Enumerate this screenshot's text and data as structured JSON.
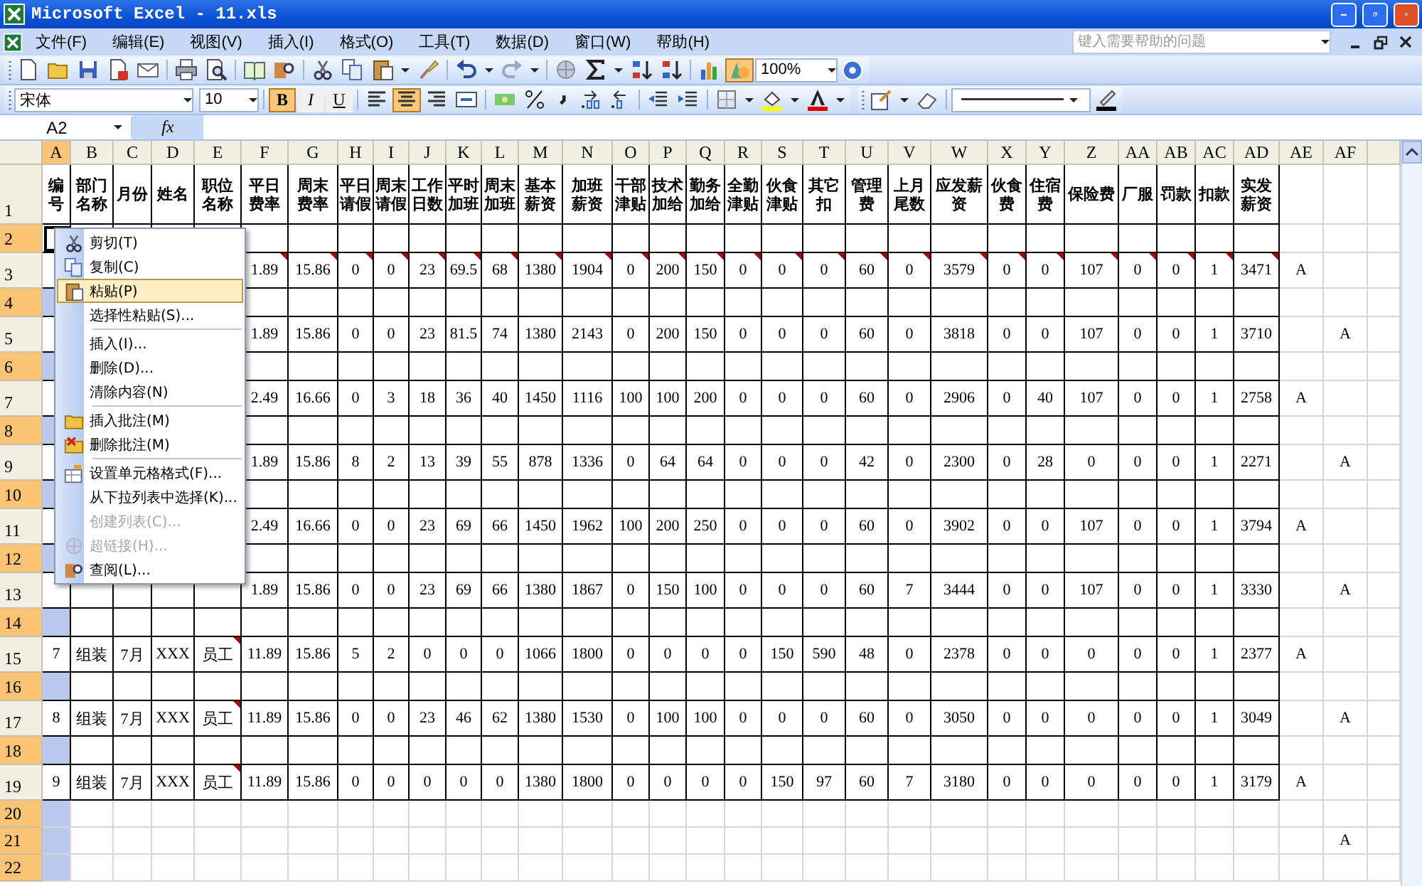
{
  "window": {
    "title": "Microsoft Excel - 11.xls"
  },
  "menu_bar": [
    "文件(F)",
    "编辑(E)",
    "视图(V)",
    "插入(I)",
    "格式(O)",
    "工具(T)",
    "数据(D)",
    "窗口(W)",
    "帮助(H)"
  ],
  "help_box": {
    "placeholder": "键入需要帮助的问题"
  },
  "standard_toolbar": {
    "zoom": "100%",
    "buttons": [
      {
        "pressed": false
      },
      {
        "pressed": false
      },
      {
        "pressed": false
      },
      {
        "pressed": false
      },
      {
        "pressed": false
      },
      {
        "pressed": false
      },
      {
        "pressed": false
      },
      {
        "pressed": false
      },
      {
        "pressed": false
      },
      {
        "pressed": false
      },
      {
        "pressed": false
      },
      {
        "pressed": false
      },
      {
        "pressed": false
      },
      {
        "pressed": false
      },
      {
        "pressed": false
      },
      {
        "pressed": false
      },
      {
        "pressed": false
      },
      {
        "pressed": false
      },
      {
        "pressed": false
      },
      {
        "pressed": false
      },
      {
        "pressed": true
      }
    ]
  },
  "formatting_toolbar": {
    "font": "宋体",
    "size": "10",
    "style_buttons": [
      {
        "label": "B",
        "pressed": true
      },
      {
        "label": "I",
        "pressed": false
      },
      {
        "label": "U",
        "pressed": false
      }
    ],
    "align_buttons": [
      {
        "pressed": false
      },
      {
        "pressed": true
      },
      {
        "pressed": false
      },
      {
        "pressed": false
      }
    ]
  },
  "formula_bar": {
    "name_box": "A2",
    "fx": "fx"
  },
  "sheet": {
    "columns": [
      {
        "label": "A",
        "selected": true
      },
      {
        "label": "B",
        "selected": false
      },
      {
        "label": "C",
        "selected": false
      },
      {
        "label": "D",
        "selected": false
      },
      {
        "label": "E",
        "selected": false
      },
      {
        "label": "F",
        "selected": false
      },
      {
        "label": "G",
        "selected": false
      },
      {
        "label": "H",
        "selected": false
      },
      {
        "label": "I",
        "selected": false
      },
      {
        "label": "J",
        "selected": false
      },
      {
        "label": "K",
        "selected": false
      },
      {
        "label": "L",
        "selected": false
      },
      {
        "label": "M",
        "selected": false
      },
      {
        "label": "N",
        "selected": false
      },
      {
        "label": "O",
        "selected": false
      },
      {
        "label": "P",
        "selected": false
      },
      {
        "label": "Q",
        "selected": false
      },
      {
        "label": "R",
        "selected": false
      },
      {
        "label": "S",
        "selected": false
      },
      {
        "label": "T",
        "selected": false
      },
      {
        "label": "U",
        "selected": false
      },
      {
        "label": "V",
        "selected": false
      },
      {
        "label": "W",
        "selected": false
      },
      {
        "label": "X",
        "selected": false
      },
      {
        "label": "Y",
        "selected": false
      },
      {
        "label": "Z",
        "selected": false
      },
      {
        "label": "AA",
        "selected": false
      },
      {
        "label": "AB",
        "selected": false
      },
      {
        "label": "AC",
        "selected": false
      },
      {
        "label": "AD",
        "selected": false
      },
      {
        "label": "AE",
        "selected": false
      },
      {
        "label": "AF",
        "selected": false
      }
    ],
    "rows": [
      {
        "label": "1",
        "kind": "header",
        "selected": false,
        "cells": [
          "编号",
          "部门名称",
          "月份",
          "姓名",
          "职位名称",
          "平日费率",
          "周末费率",
          "平日请假",
          "周末请假",
          "工作日数",
          "平时加班",
          "周末加班",
          "基本薪资",
          "加班薪资",
          "干部津贴",
          "技术加给",
          "勤务加给",
          "全勤津贴",
          "伙食津贴",
          "其它扣",
          "管理费",
          "上月尾数",
          "应发薪资",
          "伙食费",
          "住宿费",
          "保险费",
          "厂服",
          "罚款",
          "扣款",
          "实发薪资"
        ]
      },
      {
        "label": "2",
        "kind": "blank",
        "selected": true,
        "cells": [
          {
            "active": true
          }
        ]
      },
      {
        "label": "3",
        "kind": "data",
        "selected": false,
        "cells": [
          null,
          null,
          null,
          null,
          null,
          {
            "text": "1.89",
            "comment": true
          },
          {
            "text": "15.86",
            "comment": true
          },
          {
            "text": "0",
            "comment": true
          },
          {
            "text": "0",
            "comment": true
          },
          {
            "text": "23",
            "comment": true
          },
          {
            "text": "69.5",
            "comment": true
          },
          {
            "text": "68",
            "comment": true
          },
          {
            "text": "1380",
            "comment": true
          },
          {
            "text": "1904",
            "comment": true
          },
          {
            "text": "0",
            "comment": true
          },
          {
            "text": "200",
            "comment": true
          },
          {
            "text": "150",
            "comment": true
          },
          {
            "text": "0",
            "comment": true
          },
          {
            "text": "0",
            "comment": true
          },
          {
            "text": "0",
            "comment": true
          },
          {
            "text": "60",
            "comment": true
          },
          {
            "text": "0",
            "comment": true
          },
          {
            "text": "3579",
            "comment": true
          },
          {
            "text": "0",
            "comment": true
          },
          {
            "text": "0",
            "comment": true
          },
          {
            "text": "107",
            "comment": true
          },
          {
            "text": "0",
            "comment": true
          },
          {
            "text": "0",
            "comment": true
          },
          {
            "text": "1",
            "comment": true
          },
          {
            "text": "3471",
            "comment": true
          },
          "A"
        ]
      },
      {
        "label": "4",
        "kind": "blank",
        "selected": true
      },
      {
        "label": "5",
        "kind": "data",
        "selected": false,
        "cells": [
          null,
          null,
          null,
          null,
          null,
          "1.89",
          "15.86",
          "0",
          "0",
          "23",
          "81.5",
          "74",
          "1380",
          "2143",
          "0",
          "200",
          "150",
          "0",
          "0",
          "0",
          "60",
          "0",
          "3818",
          "0",
          "0",
          "107",
          "0",
          "0",
          "1",
          "3710",
          null,
          "A"
        ]
      },
      {
        "label": "6",
        "kind": "blank",
        "selected": true
      },
      {
        "label": "7",
        "kind": "data",
        "selected": false,
        "cells": [
          null,
          null,
          null,
          null,
          null,
          "2.49",
          "16.66",
          "0",
          "3",
          "18",
          "36",
          "40",
          "1450",
          "1116",
          "100",
          "100",
          "200",
          "0",
          "0",
          "0",
          "60",
          "0",
          "2906",
          "0",
          "40",
          "107",
          "0",
          "0",
          "1",
          "2758",
          "A"
        ]
      },
      {
        "label": "8",
        "kind": "blank",
        "selected": true
      },
      {
        "label": "9",
        "kind": "data",
        "selected": false,
        "cells": [
          null,
          null,
          null,
          null,
          null,
          "1.89",
          "15.86",
          "8",
          "2",
          "13",
          "39",
          "55",
          "878",
          "1336",
          "0",
          "64",
          "64",
          "0",
          "0",
          "0",
          "42",
          "0",
          "2300",
          "0",
          "28",
          "0",
          "0",
          "0",
          "1",
          "2271",
          null,
          "A"
        ]
      },
      {
        "label": "10",
        "kind": "blank",
        "selected": true
      },
      {
        "label": "11",
        "kind": "data",
        "selected": false,
        "cells": [
          null,
          null,
          null,
          null,
          null,
          "2.49",
          "16.66",
          "0",
          "0",
          "23",
          "69",
          "66",
          "1450",
          "1962",
          "100",
          "200",
          "250",
          "0",
          "0",
          "0",
          "60",
          "0",
          "3902",
          "0",
          "0",
          "107",
          "0",
          "0",
          "1",
          "3794",
          "A"
        ]
      },
      {
        "label": "12",
        "kind": "blank",
        "selected": true
      },
      {
        "label": "13",
        "kind": "data",
        "selected": false,
        "cells": [
          null,
          null,
          null,
          null,
          null,
          "1.89",
          "15.86",
          "0",
          "0",
          "23",
          "69",
          "66",
          "1380",
          "1867",
          "0",
          "150",
          "100",
          "0",
          "0",
          "0",
          "60",
          "7",
          "3444",
          "0",
          "0",
          "107",
          "0",
          "0",
          "1",
          "3330",
          null,
          "A"
        ]
      },
      {
        "label": "14",
        "kind": "blank",
        "selected": true
      },
      {
        "label": "15",
        "kind": "data",
        "selected": false,
        "cells": [
          "7",
          "组装",
          "7月",
          "XXX",
          {
            "text": "员工",
            "comment": true
          },
          "11.89",
          "15.86",
          "5",
          "2",
          "0",
          "0",
          "0",
          "1066",
          "1800",
          "0",
          "0",
          "0",
          "0",
          "150",
          "590",
          "48",
          "0",
          "2378",
          "0",
          "0",
          "0",
          "0",
          "0",
          "1",
          "2377",
          "A"
        ]
      },
      {
        "label": "16",
        "kind": "blank",
        "selected": true
      },
      {
        "label": "17",
        "kind": "data",
        "selected": false,
        "cells": [
          "8",
          "组装",
          "7月",
          "XXX",
          {
            "text": "员工",
            "comment": true
          },
          "11.89",
          "15.86",
          "0",
          "0",
          "23",
          "46",
          "62",
          "1380",
          "1530",
          "0",
          "100",
          "100",
          "0",
          "0",
          "0",
          "60",
          "0",
          "3050",
          "0",
          "0",
          "0",
          "0",
          "0",
          "1",
          "3049",
          null,
          "A"
        ]
      },
      {
        "label": "18",
        "kind": "blank",
        "selected": true
      },
      {
        "label": "19",
        "kind": "data",
        "selected": false,
        "cells": [
          "9",
          "组装",
          "7月",
          "XXX",
          {
            "text": "员工",
            "comment": true
          },
          "11.89",
          "15.86",
          "0",
          "0",
          "0",
          "0",
          "0",
          "1380",
          "1800",
          "0",
          "0",
          "0",
          "0",
          "150",
          "97",
          "60",
          "7",
          "3180",
          "0",
          "0",
          "0",
          "0",
          "0",
          "1",
          "3179",
          "A"
        ]
      },
      {
        "label": "20",
        "kind": "spare",
        "selected": true
      },
      {
        "label": "21",
        "kind": "spare",
        "selected": true,
        "cells": [
          null,
          null,
          null,
          null,
          null,
          null,
          null,
          null,
          null,
          null,
          null,
          null,
          null,
          null,
          null,
          null,
          null,
          null,
          null,
          null,
          null,
          null,
          null,
          null,
          null,
          null,
          null,
          null,
          null,
          null,
          null,
          "A"
        ]
      },
      {
        "label": "22",
        "kind": "spare",
        "selected": true
      }
    ]
  },
  "context_menu": {
    "items": [
      {
        "label": "剪切(T)",
        "selected": false,
        "disabled": false,
        "separator_after": false
      },
      {
        "label": "复制(C)",
        "selected": false,
        "disabled": false,
        "separator_after": false
      },
      {
        "label": "粘贴(P)",
        "selected": true,
        "disabled": false,
        "separator_after": false
      },
      {
        "label": "选择性粘贴(S)...",
        "selected": false,
        "disabled": false,
        "separator_after": true
      },
      {
        "label": "插入(I)...",
        "selected": false,
        "disabled": false,
        "separator_after": false
      },
      {
        "label": "删除(D)...",
        "selected": false,
        "disabled": false,
        "separator_after": false
      },
      {
        "label": "清除内容(N)",
        "selected": false,
        "disabled": false,
        "separator_after": true
      },
      {
        "label": "插入批注(M)",
        "selected": false,
        "disabled": false,
        "separator_after": false
      },
      {
        "label": "删除批注(M)",
        "selected": false,
        "disabled": false,
        "separator_after": true
      },
      {
        "label": "设置单元格格式(F)...",
        "selected": false,
        "disabled": false,
        "separator_after": false
      },
      {
        "label": "从下拉列表中选择(K)...",
        "selected": false,
        "disabled": false,
        "separator_after": false
      },
      {
        "label": "创建列表(C)...",
        "selected": false,
        "disabled": true,
        "separator_after": false
      },
      {
        "label": "超链接(H)...",
        "selected": false,
        "disabled": true,
        "separator_after": false
      },
      {
        "label": "查阅(L)...",
        "selected": false,
        "disabled": false,
        "separator_after": false
      }
    ]
  }
}
